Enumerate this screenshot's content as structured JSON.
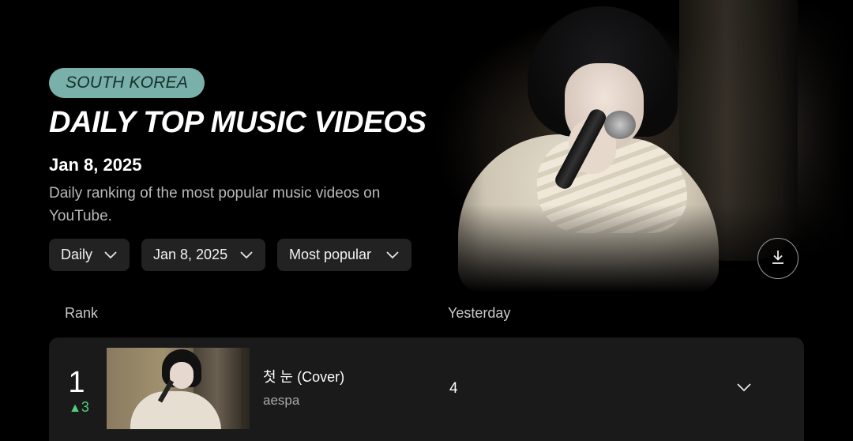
{
  "header": {
    "badge": "SOUTH KOREA",
    "title": "DAILY TOP MUSIC VIDEOS",
    "date": "Jan 8, 2025",
    "description": "Daily ranking of the most popular music videos on YouTube."
  },
  "filters": {
    "period": {
      "value": "Daily",
      "icon": "chevron-down-icon"
    },
    "date": {
      "value": "Jan 8, 2025",
      "icon": "chevron-down-icon"
    },
    "sort": {
      "value": "Most popular",
      "icon": "chevron-down-icon"
    }
  },
  "download": {
    "icon": "download-icon"
  },
  "table": {
    "columns": {
      "rank": "Rank",
      "yesterday": "Yesterday"
    },
    "rows": [
      {
        "rank": "1",
        "change": "3",
        "change_direction": "up",
        "title": "첫 눈 (Cover)",
        "artist": "aespa",
        "yesterday": "4"
      }
    ]
  },
  "colors": {
    "background": "#000000",
    "badge": "#7ab0aa",
    "rank_up": "#4fd07b",
    "surface": "#1a1a1a",
    "control": "#222222"
  }
}
